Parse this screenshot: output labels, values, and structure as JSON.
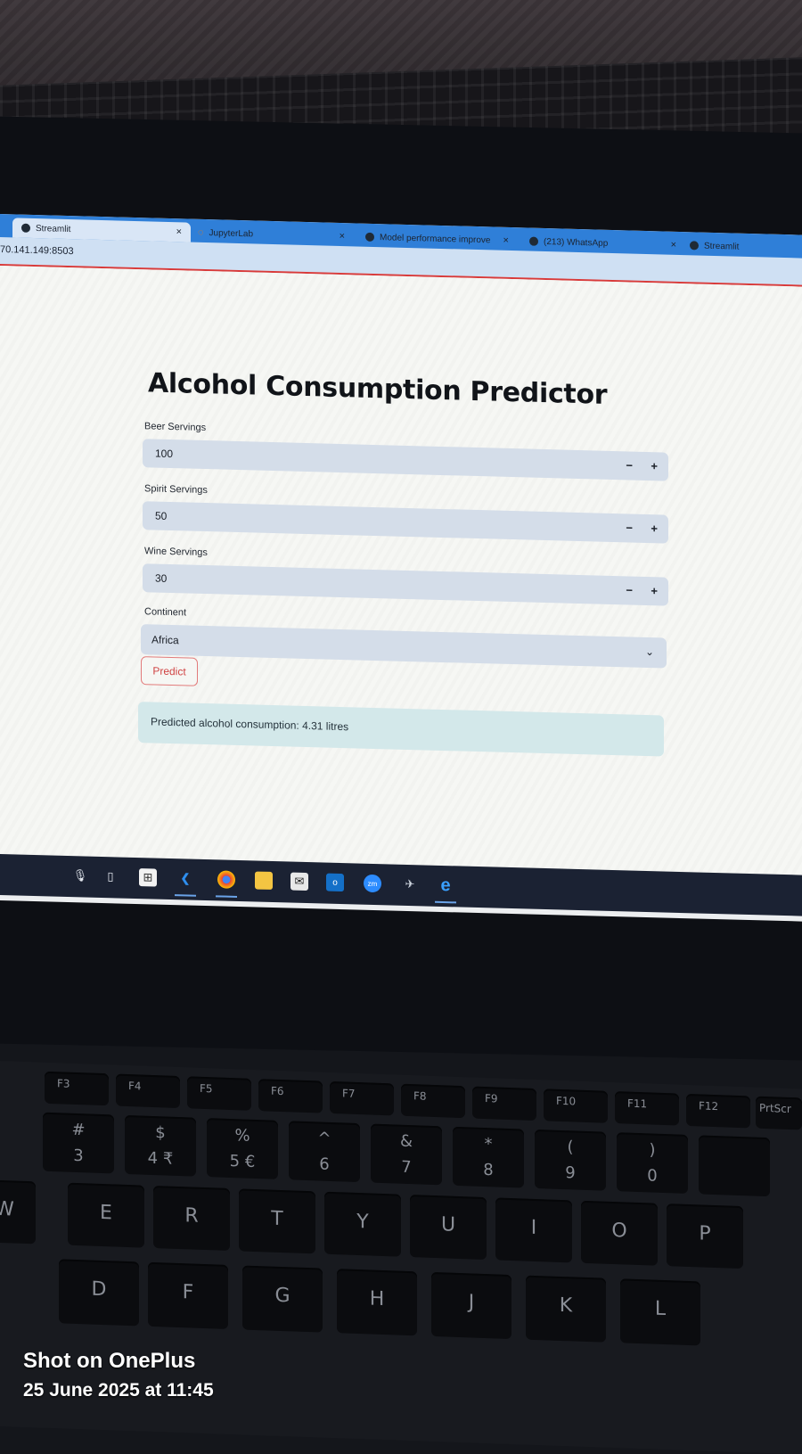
{
  "browser": {
    "tabs": [
      {
        "label": "Streamlit"
      },
      {
        "label": "JupyterLab"
      },
      {
        "label": "Model performance improve"
      },
      {
        "label": "(213) WhatsApp"
      },
      {
        "label": "Streamlit"
      }
    ],
    "url": "70.141.149:8503"
  },
  "app": {
    "title": "Alcohol Consumption Predictor",
    "beer": {
      "label": "Beer Servings",
      "value": "100"
    },
    "spirit": {
      "label": "Spirit Servings",
      "value": "50"
    },
    "wine": {
      "label": "Wine Servings",
      "value": "30"
    },
    "continent": {
      "label": "Continent",
      "value": "Africa"
    },
    "stepper": {
      "minus": "−",
      "plus": "+"
    },
    "predict_label": "Predict",
    "result_text": "Predicted alcohol consumption: 4.31 litres"
  },
  "taskbar": {
    "icons": [
      "microphone-icon",
      "task-view-icon",
      "store-icon",
      "vscode-icon",
      "chrome-icon",
      "file-explorer-icon",
      "mail-icon",
      "outlook-icon",
      "zoom-icon",
      "app-icon",
      "edge-icon"
    ],
    "zoom_label": "zm",
    "edge_label": "e"
  },
  "keyboard": {
    "fkeys": [
      "F3",
      "F4",
      "F5",
      "F6",
      "F7",
      "F8",
      "F9",
      "F10",
      "F11",
      "F12",
      "PrtScr"
    ],
    "number_row": [
      {
        "top": "#",
        "bottom": "3"
      },
      {
        "top": "$",
        "bottom": "4 ₹"
      },
      {
        "top": "%",
        "bottom": "5 €"
      },
      {
        "top": "^",
        "bottom": "6"
      },
      {
        "top": "&",
        "bottom": "7"
      },
      {
        "top": "*",
        "bottom": "8"
      },
      {
        "top": "(",
        "bottom": "9"
      },
      {
        "top": ")",
        "bottom": "0"
      }
    ],
    "top_row": [
      "W",
      "E",
      "R",
      "T",
      "Y",
      "U",
      "I",
      "O",
      "P"
    ],
    "home_row": [
      "D",
      "F",
      "G",
      "H",
      "J",
      "K",
      "L"
    ]
  },
  "watermark": {
    "line1": "Shot on OnePlus",
    "line2": "25 June 2025 at 11:45"
  }
}
